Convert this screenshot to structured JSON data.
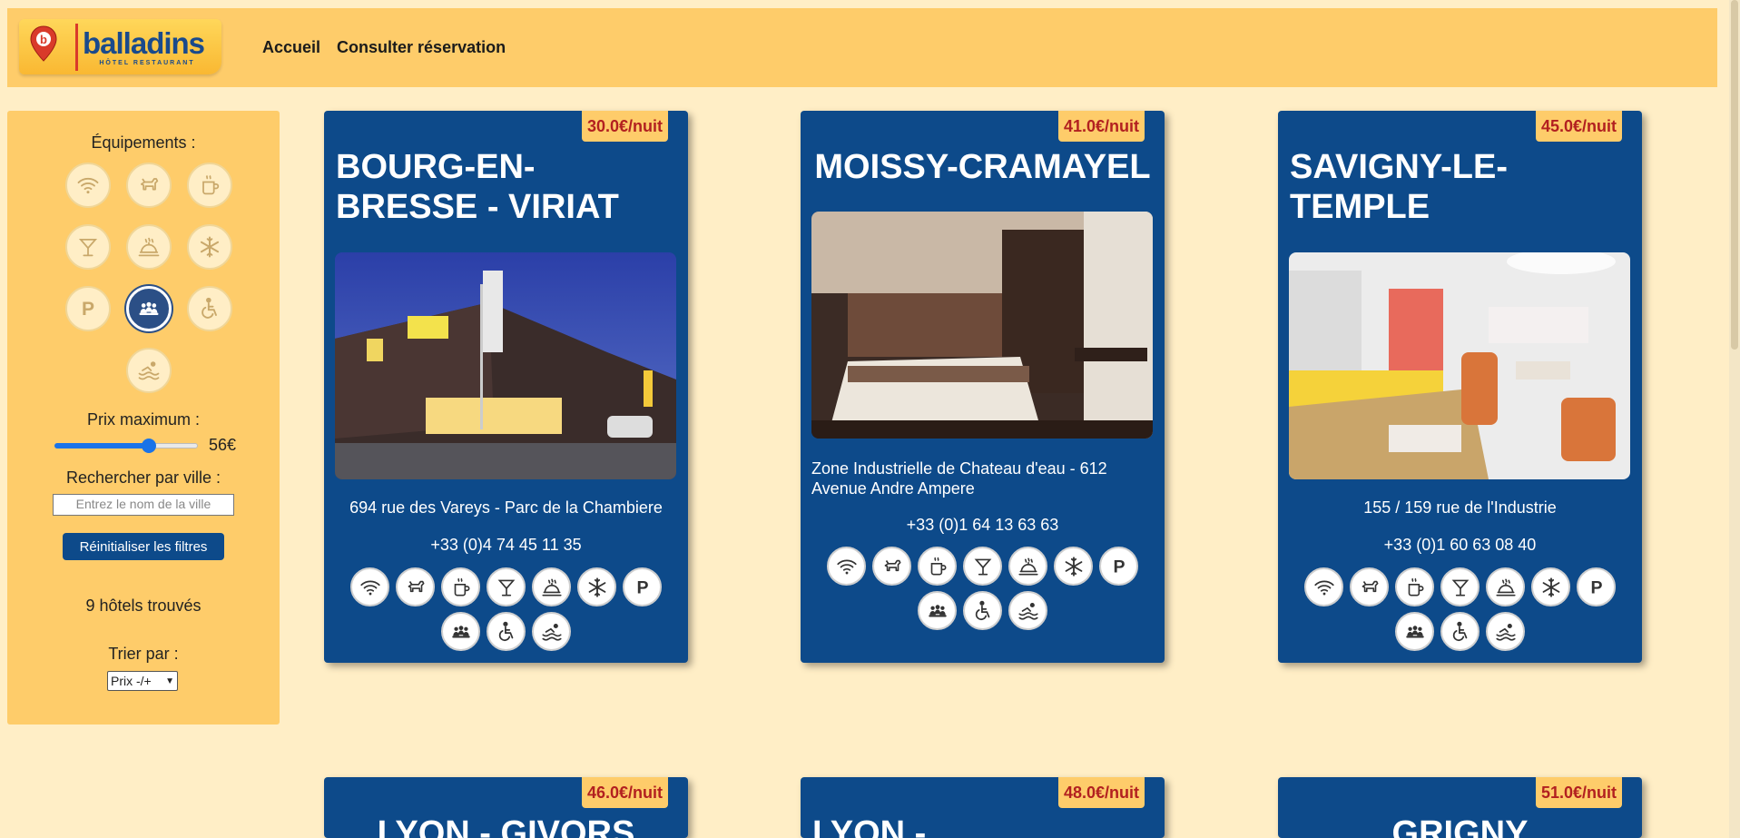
{
  "header": {
    "logo_text": "balladins",
    "logo_subtitle": "HÔTEL RESTAURANT",
    "nav": [
      {
        "label": "Accueil"
      },
      {
        "label": "Consulter réservation"
      }
    ]
  },
  "sidebar": {
    "equipments_title": "Équipements :",
    "equipments": [
      "wifi-icon",
      "pet-icon",
      "coffee-icon",
      "bar-icon",
      "restaurant-icon",
      "air-conditioning-icon",
      "parking-icon",
      "meeting-room-icon",
      "accessible-icon",
      "pool-icon"
    ],
    "active_equipment": "meeting-room-icon",
    "price_title": "Prix maximum :",
    "price_value": "56€",
    "price_slider_fraction": 0.66,
    "city_title": "Rechercher par ville :",
    "city_placeholder": "Entrez le nom de la ville",
    "reset_label": "Réinitialiser les filtres",
    "found_text": "9 hôtels trouvés",
    "sort_title": "Trier par :",
    "sort_value": "Prix -/+"
  },
  "hotels": [
    {
      "price": "30.0€/nuit",
      "name": "BOURG-EN-BRESSE - VIRIAT",
      "address": "694 rue des Vareys - Parc de la Chambiere",
      "phone": "+33 (0)4 74 45 11 35"
    },
    {
      "price": "41.0€/nuit",
      "name": "MOISSY-CRAMAYEL",
      "address": "Zone Industrielle de Chateau d'eau - 612 Avenue Andre Ampere",
      "phone": "+33 (0)1 64 13 63 63"
    },
    {
      "price": "45.0€/nuit",
      "name": "SAVIGNY-LE-TEMPLE",
      "address": "155 / 159 rue de l'Industrie",
      "phone": "+33 (0)1 60 63 08 40"
    },
    {
      "price": "46.0€/nuit",
      "name": "LYON - GIVORS"
    },
    {
      "price": "48.0€/nuit",
      "name": "LYON -"
    },
    {
      "price": "51.0€/nuit",
      "name": "GRIGNY"
    }
  ],
  "colors": {
    "header": "#fecc6a",
    "background": "#ffeec6",
    "card": "#0d4a8a",
    "price": "#b22020"
  }
}
